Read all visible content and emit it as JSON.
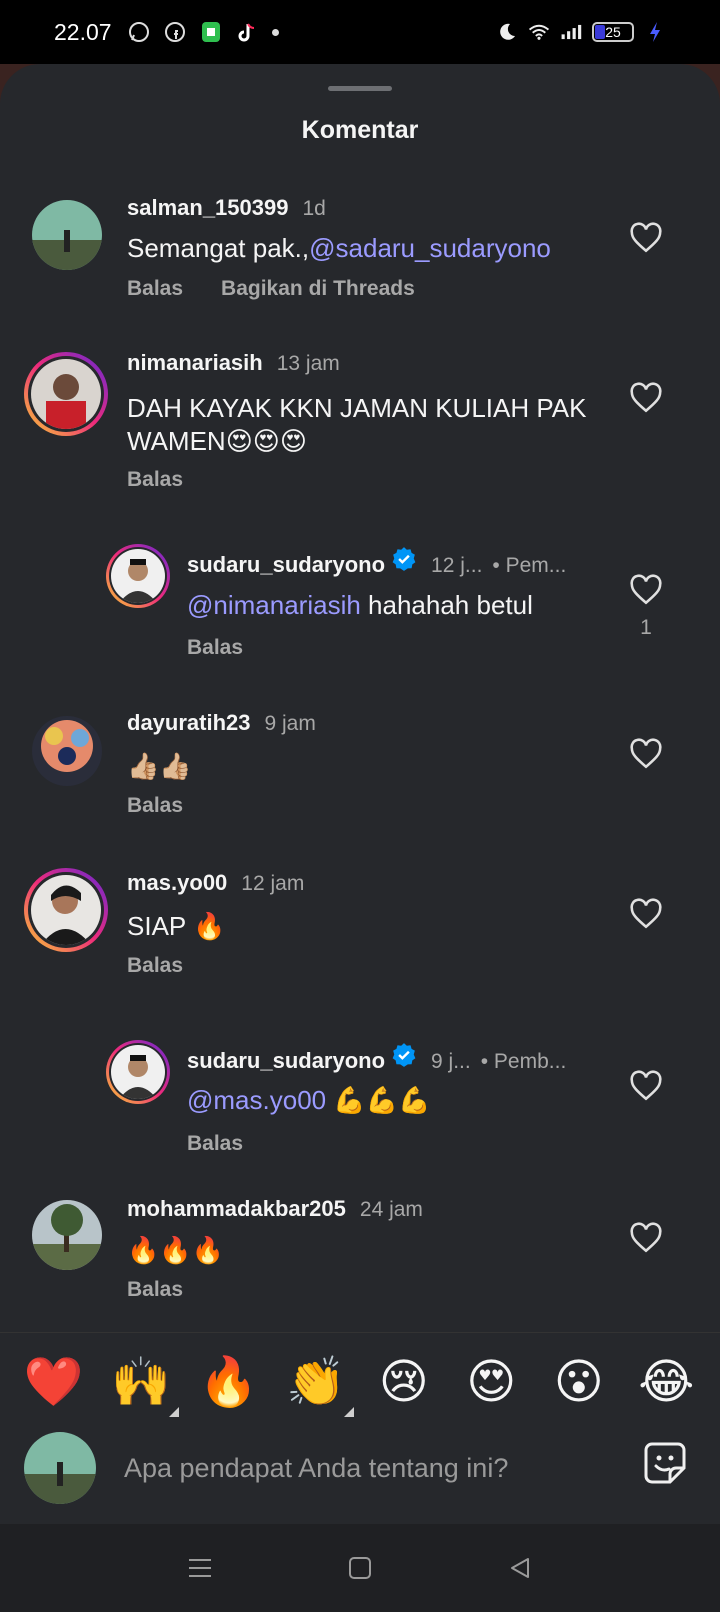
{
  "status_bar": {
    "time": "22.07",
    "battery": "25"
  },
  "sheet": {
    "title": "Komentar"
  },
  "comments": [
    {
      "user": "salman_150399",
      "time": "1d",
      "text_plain": "Semangat pak.,",
      "mention": "@sadaru_sudaryono",
      "reply_label": "Balas",
      "share_label": "Bagikan di Threads"
    },
    {
      "user": "nimanariasih",
      "time": "13 jam",
      "text": "DAH KAYAK KKN JAMAN KULIAH PAK WAMEN😍😍😍",
      "reply_label": "Balas"
    },
    {
      "user": "sudaru_sudaryono",
      "time": "12 j...",
      "tag": "• Pem...",
      "mention": "@nimanariasih",
      "text_plain": " hahahah betul",
      "reply_label": "Balas",
      "likes": "1"
    },
    {
      "user": "dayuratih23",
      "time": "9 jam",
      "text": "👍🏼👍🏼",
      "reply_label": "Balas"
    },
    {
      "user": "mas.yo00",
      "time": "12 jam",
      "text": "SIAP 🔥",
      "reply_label": "Balas"
    },
    {
      "user": "sudaru_sudaryono",
      "time": "9 j...",
      "tag": "• Pemb...",
      "mention": "@mas.yo00",
      "text_plain": " 💪💪💪",
      "reply_label": "Balas"
    },
    {
      "user": "mohammadakbar205",
      "time": "24 jam",
      "text": "🔥🔥🔥",
      "reply_label": "Balas"
    }
  ],
  "emoji_bar": [
    "❤️",
    "🙌",
    "🔥",
    "👏",
    "😢",
    "😍",
    "😮",
    "😂"
  ],
  "composer": {
    "placeholder": "Apa pendapat Anda tentang ini?"
  },
  "colors": {
    "sheet_bg": "#26282c",
    "mention": "#9b9bff",
    "secondary_text": "#a8a8a8",
    "verified": "#0095f6"
  }
}
